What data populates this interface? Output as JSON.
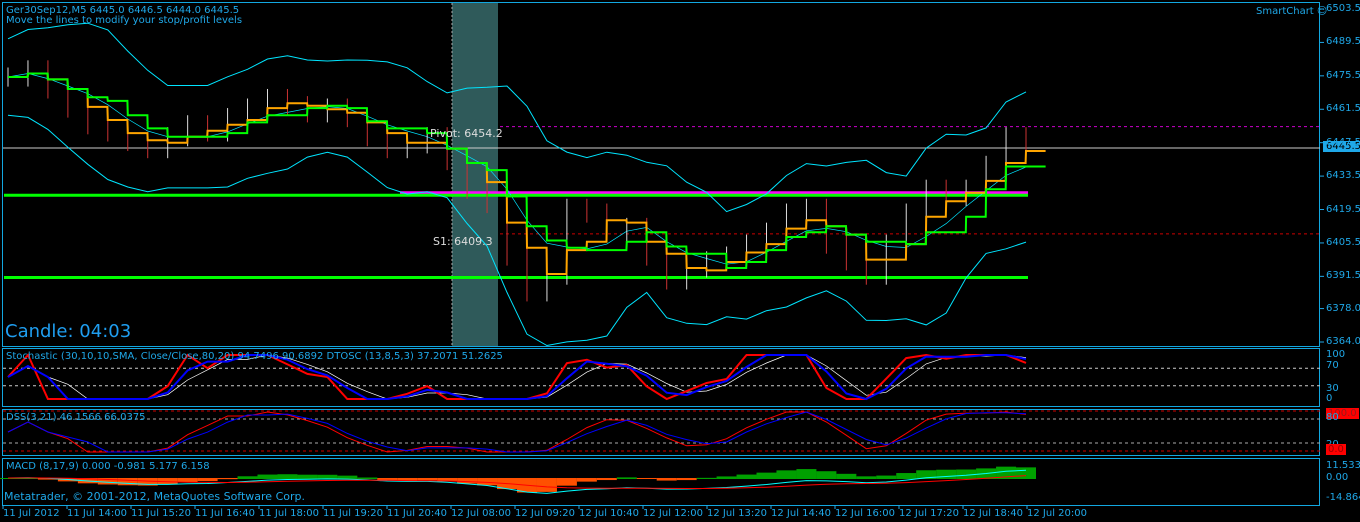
{
  "header": {
    "symbol_line": "Ger30Sep12,M5  6445.0 6446.5 6444.0 6445.5",
    "hint": "Move the lines to modify your stop/profit levels",
    "smartchart": "SmartChart",
    "smiley_icon": "smiley-icon"
  },
  "labels": {
    "pivot": "Pivot: 6454.2",
    "s1": "S1: 6409.3",
    "candle": "Candle:  04:03",
    "current_price": "6445.5",
    "copyright": "Metatrader, © 2001-2012, MetaQuotes Software Corp."
  },
  "indicators": {
    "stochastic": "Stochastic (30,10,10,SMA, Close/Close,80,20) 94.7496 90.6892  DTOSC (13,8,5,3) 37.2071 51.2625",
    "dss": "DSS(3,21) 46.1566 66.0375",
    "macd": "MACD  (8,17,9) 0.000 -0.981 5.177 6.158"
  },
  "colors": {
    "accent": "#1fa8e8",
    "pivot": "#ff00ff",
    "support": "#00ff00",
    "price": "#ffa500",
    "bands": "#00e5ff",
    "stoch_k": "#ff0000",
    "stoch_d": "#0000ff",
    "macd_up": "#00a000",
    "macd_down": "#ff5000"
  },
  "chart_data": {
    "type": "line",
    "title": "Ger30Sep12,M5",
    "ylim": [
      6364.0,
      6503.5
    ],
    "price_ticks": [
      "6503.5",
      "6489.5",
      "6475.5",
      "6461.5",
      "6447.5",
      "6433.5",
      "6419.5",
      "6405.5",
      "6391.5",
      "6378.0",
      "6364.0"
    ],
    "x_ticks": [
      "11 Jul 2012",
      "11 Jul 14:00",
      "11 Jul 15:20",
      "11 Jul 16:40",
      "11 Jul 18:00",
      "11 Jul 19:20",
      "11 Jul 20:40",
      "12 Jul 08:00",
      "12 Jul 09:20",
      "12 Jul 10:40",
      "12 Jul 12:00",
      "12 Jul 13:20",
      "12 Jul 14:40",
      "12 Jul 16:00",
      "12 Jul 17:20",
      "12 Jul 18:40",
      "12 Jul 20:00"
    ],
    "close": [
      6475,
      6478,
      6470,
      6462,
      6455,
      6452,
      6448,
      6445,
      6450,
      6455,
      6452,
      6458,
      6462,
      6466,
      6463,
      6460,
      6462,
      6458,
      6450,
      6445,
      6447,
      6450,
      6440,
      6428,
      6422,
      6400,
      6385,
      6392,
      6420,
      6418,
      6410,
      6412,
      6400,
      6390,
      6395,
      6398,
      6400,
      6405,
      6410,
      6418,
      6420,
      6405,
      6398,
      6392,
      6405,
      6418,
      6428,
      6425,
      6428,
      6438,
      6450,
      6445.5
    ],
    "levels": {
      "pivot": 6454.2,
      "s1": 6409.3,
      "magenta_line": 6426.5,
      "green_upper": 6425.5,
      "green_lower": 6391.0
    },
    "stoch_ticks": [
      "100",
      "70",
      "30",
      "0"
    ],
    "dss_ticks": [
      "100.0",
      "80",
      "20",
      "0.0"
    ],
    "macd_ticks": [
      "11.533",
      "0.00",
      "-14.864"
    ]
  }
}
